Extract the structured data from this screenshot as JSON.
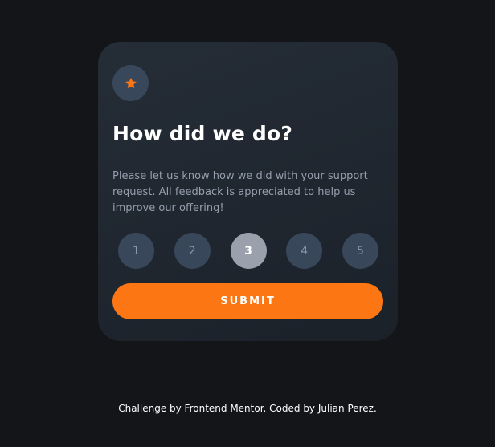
{
  "colors": {
    "background": "#131518",
    "card": "#252d37",
    "badge": "#39475b",
    "selected": "#9aa1ad",
    "accent": "#fc7614",
    "muted_text": "#969fad"
  },
  "card": {
    "icon": "star-icon",
    "title": "How did we do?",
    "description": "Please let us know how we did with your support request. All feedback is appreciated to help us improve our offering!",
    "ratings": [
      "1",
      "2",
      "3",
      "4",
      "5"
    ],
    "selected_rating": "3",
    "submit_label": "SUBMIT"
  },
  "footer": {
    "attribution": "Challenge by Frontend Mentor. Coded by Julian Perez."
  }
}
